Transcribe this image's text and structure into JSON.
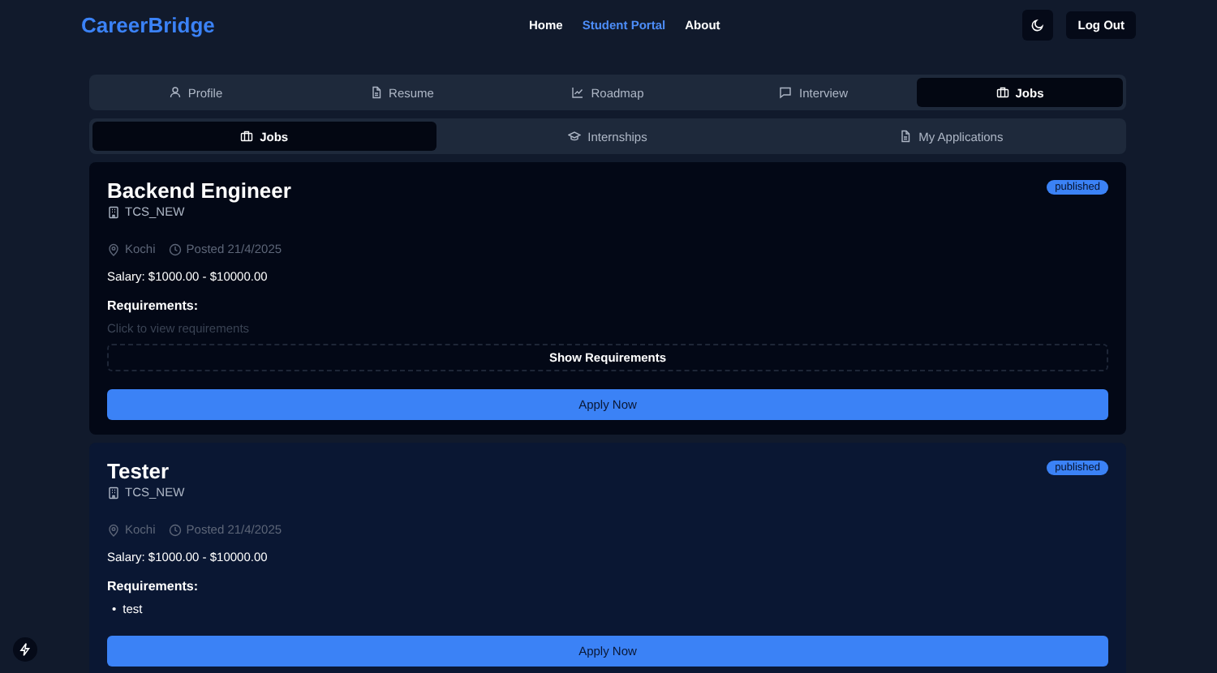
{
  "header": {
    "logo": "CareerBridge",
    "nav": [
      {
        "label": "Home",
        "selected": false
      },
      {
        "label": "Student Portal",
        "selected": true
      },
      {
        "label": "About",
        "selected": false
      }
    ],
    "logout": "Log Out"
  },
  "tabs": [
    {
      "label": "Profile",
      "selected": false
    },
    {
      "label": "Resume",
      "selected": false
    },
    {
      "label": "Roadmap",
      "selected": false
    },
    {
      "label": "Interview",
      "selected": false
    },
    {
      "label": "Jobs",
      "selected": true
    }
  ],
  "subtabs": [
    {
      "label": "Jobs",
      "selected": true
    },
    {
      "label": "Internships",
      "selected": false
    },
    {
      "label": "My Applications",
      "selected": false
    }
  ],
  "jobs": [
    {
      "title": "Backend Engineer",
      "company": "TCS_NEW",
      "status": "published",
      "location": "Kochi",
      "posted": "Posted 21/4/2025",
      "salary": "Salary: $1000.00 - $10000.00",
      "requirements_heading": "Requirements:",
      "requirements": {
        "expanded": false,
        "hint": "Click to view requirements",
        "toggle": "Show Requirements"
      },
      "apply": "Apply Now"
    },
    {
      "title": "Tester",
      "company": "TCS_NEW",
      "status": "published",
      "location": "Kochi",
      "posted": "Posted 21/4/2025",
      "salary": "Salary: $1000.00 - $10000.00",
      "requirements_heading": "Requirements:",
      "requirements": {
        "expanded": true,
        "items": [
          {
            "bullet": "•",
            "text": "test"
          }
        ]
      },
      "apply": "Apply Now"
    }
  ]
}
